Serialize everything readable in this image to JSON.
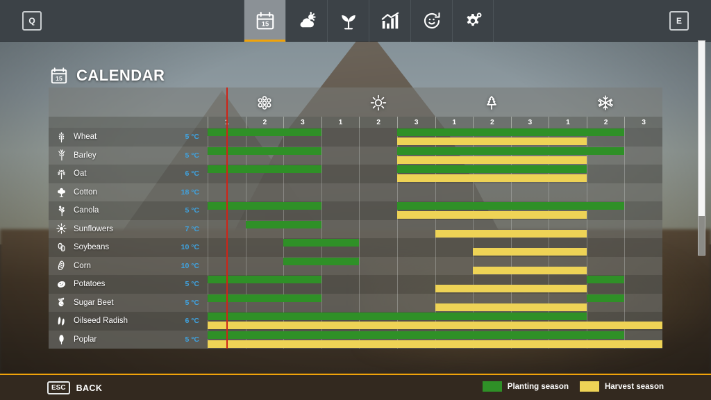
{
  "topbar": {
    "left_key": "Q",
    "right_key": "E",
    "tabs": [
      {
        "name": "calendar",
        "icon": "calendar-icon",
        "active": true
      },
      {
        "name": "weather",
        "icon": "weather-icon",
        "active": false
      },
      {
        "name": "plants",
        "icon": "seedling-icon",
        "active": false
      },
      {
        "name": "statistics",
        "icon": "bar-chart-icon",
        "active": false
      },
      {
        "name": "production",
        "icon": "cycle-icon",
        "active": false
      },
      {
        "name": "settings",
        "icon": "gears-icon",
        "active": false
      }
    ],
    "active_accent": "#f0a30a"
  },
  "header": {
    "title": "CALENDAR",
    "icon": "calendar-icon"
  },
  "calendar": {
    "seasons": [
      {
        "name": "spring",
        "icon": "blossom-icon",
        "months": [
          "1",
          "2",
          "3"
        ]
      },
      {
        "name": "summer",
        "icon": "sun-icon",
        "months": [
          "1",
          "2",
          "3"
        ]
      },
      {
        "name": "autumn",
        "icon": "leaf-icon",
        "months": [
          "1",
          "2",
          "3"
        ]
      },
      {
        "name": "winter",
        "icon": "snowflake-icon",
        "months": [
          "1",
          "2",
          "3"
        ]
      }
    ],
    "current_period_marker_month": 1,
    "temperature_unit": "°C",
    "colors": {
      "planting": "#2f9027",
      "harvest": "#eed356",
      "marker": "#cf2418",
      "temperature_text": "#3fa3e0"
    },
    "crops": [
      {
        "name": "Wheat",
        "icon": "wheat-icon",
        "temperature": "5 °C",
        "planting": [
          [
            0,
            3
          ],
          [
            5,
            11
          ]
        ],
        "harvest": [
          [
            5,
            10
          ]
        ]
      },
      {
        "name": "Barley",
        "icon": "barley-icon",
        "temperature": "5 °C",
        "planting": [
          [
            0,
            3
          ],
          [
            5,
            11
          ]
        ],
        "harvest": [
          [
            5,
            10
          ]
        ]
      },
      {
        "name": "Oat",
        "icon": "oat-icon",
        "temperature": "6 °C",
        "planting": [
          [
            0,
            3
          ],
          [
            5,
            10
          ]
        ],
        "harvest": [
          [
            5,
            10
          ]
        ]
      },
      {
        "name": "Cotton",
        "icon": "cotton-icon",
        "temperature": "18 °C",
        "planting": [],
        "harvest": []
      },
      {
        "name": "Canola",
        "icon": "canola-icon",
        "temperature": "5 °C",
        "planting": [
          [
            0,
            3
          ],
          [
            5,
            11
          ]
        ],
        "harvest": [
          [
            5,
            10
          ]
        ]
      },
      {
        "name": "Sunflowers",
        "icon": "sunflower-icon",
        "temperature": "7 °C",
        "planting": [
          [
            1,
            3
          ]
        ],
        "harvest": [
          [
            6,
            10
          ]
        ]
      },
      {
        "name": "Soybeans",
        "icon": "soybean-icon",
        "temperature": "10 °C",
        "planting": [
          [
            2,
            4
          ]
        ],
        "harvest": [
          [
            7,
            10
          ]
        ]
      },
      {
        "name": "Corn",
        "icon": "corn-icon",
        "temperature": "10 °C",
        "planting": [
          [
            2,
            4
          ]
        ],
        "harvest": [
          [
            7,
            10
          ]
        ]
      },
      {
        "name": "Potatoes",
        "icon": "potato-icon",
        "temperature": "5 °C",
        "planting": [
          [
            0,
            3
          ],
          [
            10,
            11
          ]
        ],
        "harvest": [
          [
            6,
            10
          ]
        ]
      },
      {
        "name": "Sugar Beet",
        "icon": "sugarbeet-icon",
        "temperature": "5 °C",
        "planting": [
          [
            0,
            3
          ],
          [
            10,
            11
          ]
        ],
        "harvest": [
          [
            6,
            10
          ]
        ]
      },
      {
        "name": "Oilseed Radish",
        "icon": "oilseedradish-icon",
        "temperature": "6 °C",
        "planting": [
          [
            0,
            10
          ]
        ],
        "harvest": [
          [
            0,
            12
          ]
        ]
      },
      {
        "name": "Poplar",
        "icon": "poplar-icon",
        "temperature": "5 °C",
        "planting": [
          [
            0,
            11
          ]
        ],
        "harvest": [
          [
            0,
            12
          ]
        ]
      }
    ]
  },
  "footer": {
    "back_key": "ESC",
    "back_label": "BACK",
    "legend": [
      {
        "label": "Planting season",
        "color": "#2f9027"
      },
      {
        "label": "Harvest season",
        "color": "#eed356"
      }
    ]
  }
}
